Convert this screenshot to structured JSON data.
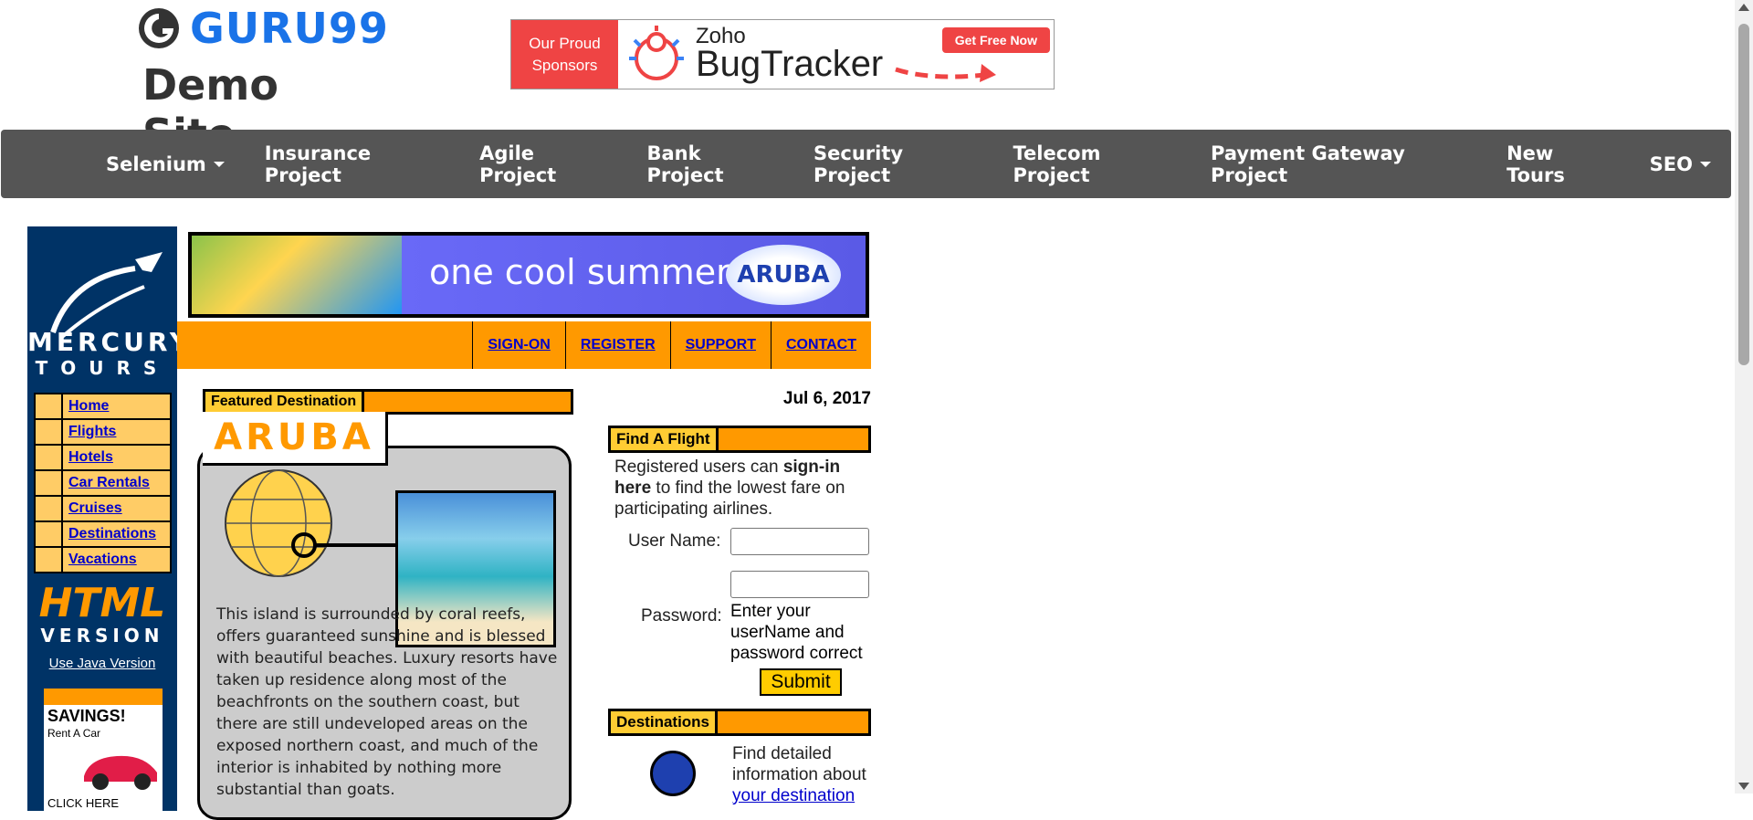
{
  "header": {
    "brand": "GURU99",
    "subtitle": "Demo Site",
    "sponsor": {
      "tag_line1": "Our Proud",
      "tag_line2": "Sponsors",
      "product_small": "Zoho",
      "product": "BugTracker",
      "cta": "Get Free Now"
    }
  },
  "nav": {
    "items": [
      "Selenium",
      "Insurance Project",
      "Agile Project",
      "Bank Project",
      "Security Project",
      "Telecom Project",
      "Payment Gateway Project",
      "New Tours",
      "SEO"
    ],
    "dropdown_items": [
      "Selenium",
      "SEO"
    ]
  },
  "mercury": {
    "logo_line1": "MERCURY",
    "logo_line2": "TOURS",
    "banner_text": "one cool summer",
    "banner_logo": "ARUBA",
    "top_links": [
      "SIGN-ON",
      "REGISTER",
      "SUPPORT",
      "CONTACT"
    ],
    "left_nav": [
      "Home",
      "Flights",
      "Hotels",
      "Car Rentals",
      "Cruises",
      "Destinations",
      "Vacations"
    ],
    "html_version": "HTML",
    "version_label": "VERSION",
    "java_link": "Use Java Version",
    "ad": {
      "title": "SAVINGS!",
      "subtitle": "Rent A Car",
      "cta": "CLICK HERE"
    },
    "featured": {
      "label": "Featured Destination",
      "title": "ARUBA",
      "description": "This island is surrounded by coral reefs, offers guaranteed sunshine and is blessed with beautiful beaches. Luxury resorts have taken up residence along most of the beachfronts on the southern coast, but there are still undeveloped areas on the exposed northern coast, and much of the interior is inhabited by nothing more substantial than goats."
    },
    "date": "Jul 6, 2017",
    "find_flight": {
      "label": "Find A Flight",
      "text_before": "Registered users can ",
      "text_bold": "sign-in here",
      "text_after": " to find the lowest fare on participating airlines.",
      "username_label": "User Name:",
      "password_label": "Password:",
      "error": "Enter your userName and password correct",
      "submit": "Submit"
    },
    "destinations": {
      "label": "Destinations",
      "text": "Find detailed information about",
      "link": "your destination"
    }
  },
  "colors": {
    "navbar": "#555555",
    "mercury_blue": "#003366",
    "orange": "#ff9900",
    "link": "#0000cc"
  }
}
